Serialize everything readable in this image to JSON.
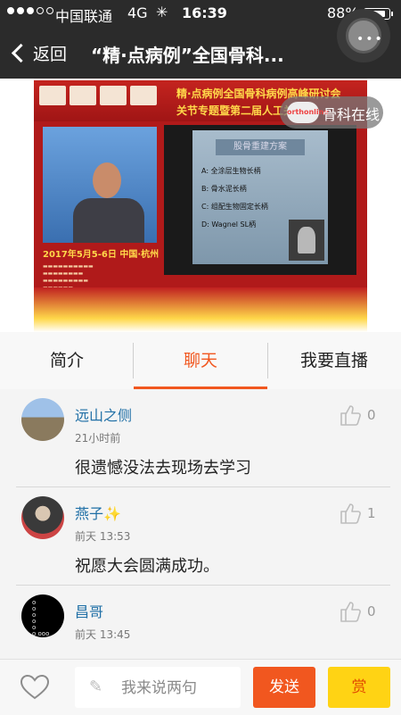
{
  "status_bar": {
    "carrier": "中国联通",
    "network": "4G",
    "time": "16:39",
    "battery": "88%",
    "battery_level": 0.88,
    "signal_bars_full": 3,
    "signal_bars_total": 5
  },
  "navbar": {
    "back_label": "返回",
    "title": "“精·点病例”全国骨科..."
  },
  "player": {
    "banner_line1": "精·点病例全国骨科病例高峰研讨会",
    "banner_line2": "关节专题暨第二届人工关节",
    "watermark": "骨科在线",
    "watermark_logo": "orthonline",
    "event_date": "2017年5月5-6日   中国·杭州",
    "slide_title": "股骨重建方案",
    "slide_options": [
      "A:  全涂层生物长柄",
      "B:  骨水泥长柄",
      "C:  组配生物固定长柄",
      "D:  Wagnel SL柄"
    ]
  },
  "tabs": [
    {
      "label": "简介",
      "active": false
    },
    {
      "label": "聊天",
      "active": true
    },
    {
      "label": "我要直播",
      "active": false
    }
  ],
  "comments": [
    {
      "name": "远山之侧",
      "time": "21小时前",
      "message": "很遗憾没法去现场去学习",
      "likes": "0",
      "badge": ""
    },
    {
      "name": "燕子",
      "time": "前天 13:53",
      "message": "祝愿大会圆满成功。",
      "likes": "1",
      "badge": "✨"
    },
    {
      "name": "昌哥",
      "time": "前天 13:45",
      "message": "",
      "likes": "0",
      "badge": ""
    }
  ],
  "bottom_bar": {
    "input_placeholder": "我来说两句",
    "send_label": "发送",
    "reward_label": "赏"
  },
  "colors": {
    "accent": "#f1571f",
    "reward": "#ffd314",
    "name_link": "#1f6fa6",
    "bar": "#2b2b2b"
  }
}
